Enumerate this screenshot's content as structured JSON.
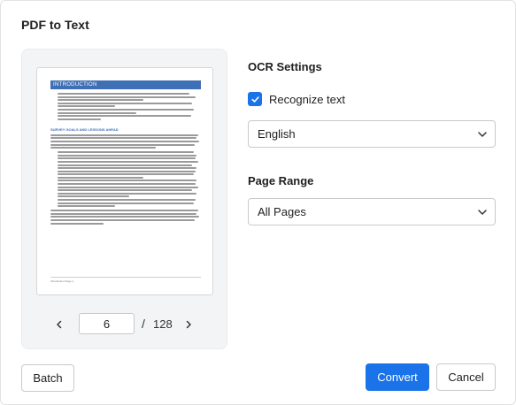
{
  "dialog": {
    "title": "PDF to Text"
  },
  "preview": {
    "page_heading": "INTRODUCTION",
    "sub_heading": "SURVEY GOALS AND LESSONS AHEAD",
    "footer": "Introduction Page 1"
  },
  "pager": {
    "current_page": "6",
    "separator": "/",
    "total_pages": "128"
  },
  "ocr": {
    "section_label": "OCR Settings",
    "recognize_label": "Recognize text",
    "recognize_checked": true,
    "language": "English"
  },
  "range": {
    "section_label": "Page Range",
    "selected": "All Pages"
  },
  "buttons": {
    "batch": "Batch",
    "convert": "Convert",
    "cancel": "Cancel"
  },
  "colors": {
    "accent": "#1a73e8",
    "preview_heading": "#3f6fb4"
  },
  "icons": {
    "prev": "chevron-left-icon",
    "next": "chevron-right-icon",
    "checkbox": "check-icon",
    "dropdown": "chevron-down-icon"
  }
}
